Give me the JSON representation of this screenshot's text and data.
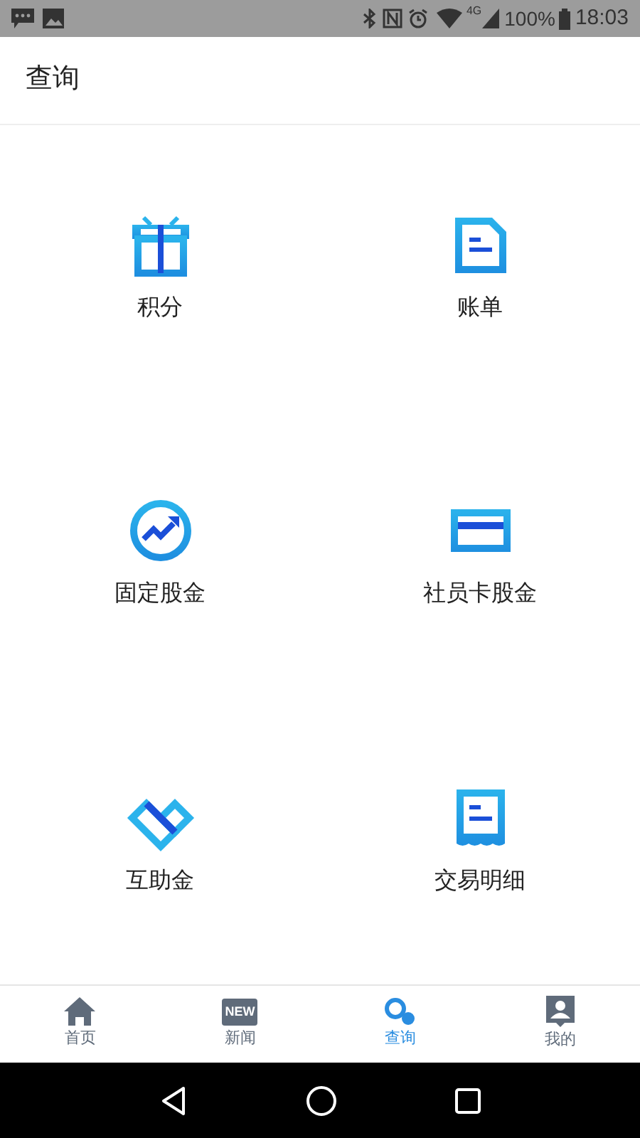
{
  "status_bar": {
    "network": "4G",
    "battery": "100%",
    "time": "18:03"
  },
  "header": {
    "title": "查询"
  },
  "grid": [
    {
      "label": "积分"
    },
    {
      "label": "账单"
    },
    {
      "label": "固定股金"
    },
    {
      "label": "社员卡股金"
    },
    {
      "label": "互助金"
    },
    {
      "label": "交易明细"
    }
  ],
  "tab_bar": [
    {
      "label": "首页",
      "selected": false
    },
    {
      "label": "新闻",
      "badge": "NEW",
      "selected": false
    },
    {
      "label": "查询",
      "selected": true
    },
    {
      "label": "我的",
      "selected": false
    }
  ]
}
